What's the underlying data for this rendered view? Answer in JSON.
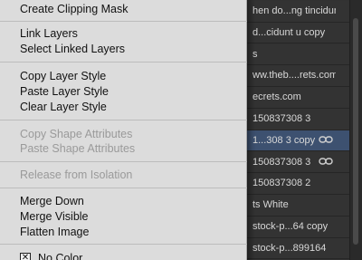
{
  "layers": [
    {
      "name": "hen do...ng tincidunt u",
      "selected": false,
      "linked": false
    },
    {
      "name": "d...cidunt u copy",
      "selected": false,
      "linked": false
    },
    {
      "name": "s",
      "selected": false,
      "linked": false
    },
    {
      "name": "ww.theb....rets.com",
      "selected": false,
      "linked": false
    },
    {
      "name": "ecrets.com",
      "selected": false,
      "linked": false
    },
    {
      "name": "150837308 3",
      "selected": false,
      "linked": false
    },
    {
      "name": "1...308 3 copy",
      "selected": true,
      "linked": true
    },
    {
      "name": "150837308 3",
      "selected": false,
      "linked": true
    },
    {
      "name": "150837308 2",
      "selected": false,
      "linked": false
    },
    {
      "name": "ts White",
      "selected": false,
      "linked": false
    },
    {
      "name": "stock-p...64 copy",
      "selected": false,
      "linked": false
    },
    {
      "name": "stock-p...899164",
      "selected": false,
      "linked": false
    }
  ],
  "menu": {
    "create_clipping_mask": "Create Clipping Mask",
    "link_layers": "Link Layers",
    "select_linked_layers": "Select Linked Layers",
    "copy_layer_style": "Copy Layer Style",
    "paste_layer_style": "Paste Layer Style",
    "clear_layer_style": "Clear Layer Style",
    "copy_shape_attributes": "Copy Shape Attributes",
    "paste_shape_attributes": "Paste Shape Attributes",
    "release_from_isolation": "Release from Isolation",
    "merge_down": "Merge Down",
    "merge_visible": "Merge Visible",
    "flatten_image": "Flatten Image",
    "no_color": "No Color"
  },
  "icons": {
    "link": "link-icon",
    "checkbox": "checkbox-icon"
  }
}
